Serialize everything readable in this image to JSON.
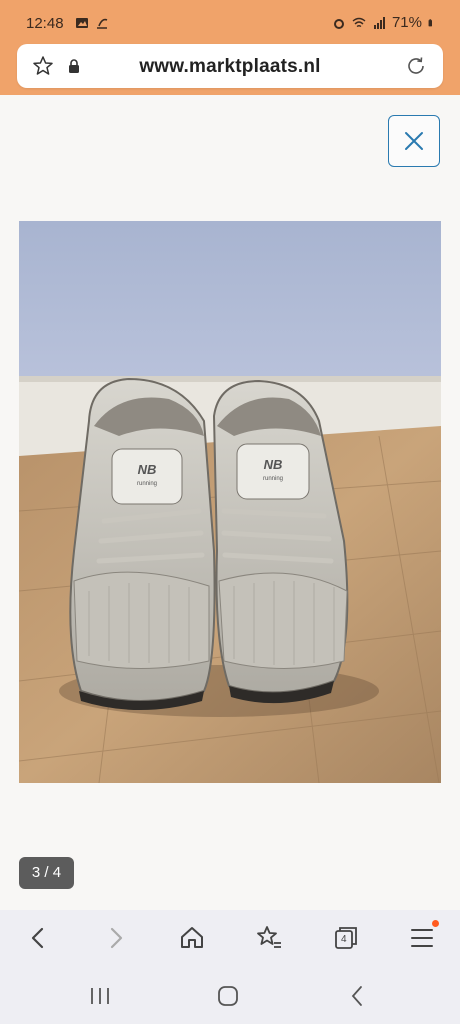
{
  "status_bar": {
    "time": "12:48",
    "battery": "71%",
    "icons_left": [
      "gallery-icon",
      "sleep-icon"
    ],
    "icons_right": [
      "alarm-icon",
      "wifi-icon",
      "signal-icon",
      "battery-icon"
    ]
  },
  "browser": {
    "url": "www.marktplaats.nl",
    "tab_count": "4"
  },
  "viewer": {
    "counter": "3 / 4",
    "image_description": "Pair of white and silver New Balance running sneakers on wooden floor"
  },
  "colors": {
    "top_bar": "#f0a36a",
    "close_border": "#2a7ab0",
    "accent_dot": "#ff5a1f"
  }
}
